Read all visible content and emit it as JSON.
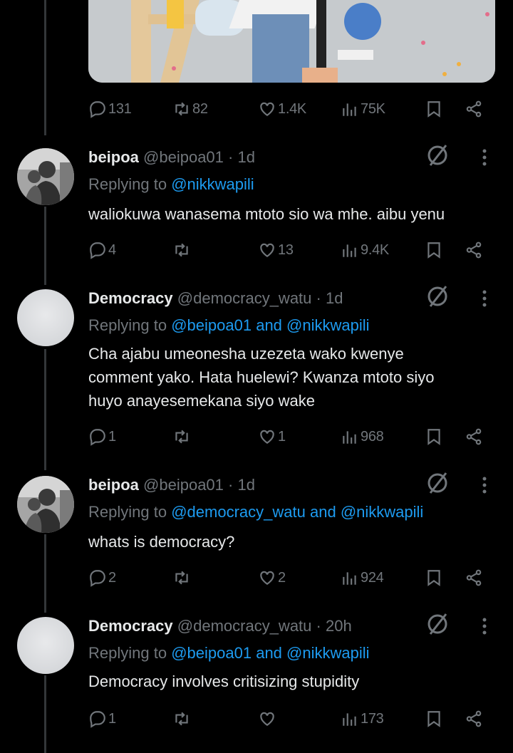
{
  "top_tweet": {
    "metrics": {
      "replies": "131",
      "reposts": "82",
      "likes": "1.4K",
      "views": "75K"
    }
  },
  "tweets": [
    {
      "name": "beipoa",
      "handle": "@beipoa01",
      "time": "· 1d",
      "replying_prefix": "Replying to",
      "replying_to": "@nikkwapili",
      "replying_and": "",
      "replying_to2": "",
      "text_lines": [
        "waliokuwa wanasema mtoto sio wa mhe. aibu yenu"
      ],
      "metrics": {
        "replies": "4",
        "reposts": "",
        "likes": "13",
        "views": "9.4K"
      },
      "avatar": "photo"
    },
    {
      "name": "Democracy",
      "handle": "@democracy_watu",
      "time": "· 1d",
      "replying_prefix": "Replying to",
      "replying_to": "@beipoa01",
      "replying_and": "and",
      "replying_to2": "@nikkwapili",
      "text_lines": [
        "Cha ajabu umeonesha uzezeta wako kwenye",
        "comment yako. Hata huelewi? Kwanza mtoto siyo",
        "huyo anayesemekana siyo wake"
      ],
      "metrics": {
        "replies": "1",
        "reposts": "",
        "likes": "1",
        "views": "968"
      },
      "avatar": "grey"
    },
    {
      "name": "beipoa",
      "handle": "@beipoa01",
      "time": "· 1d",
      "replying_prefix": "Replying to",
      "replying_to": "@democracy_watu",
      "replying_and": "and",
      "replying_to2": "@nikkwapili",
      "text_lines": [
        "whats is democracy?"
      ],
      "metrics": {
        "replies": "2",
        "reposts": "",
        "likes": "2",
        "views": "924"
      },
      "avatar": "photo"
    },
    {
      "name": "Democracy",
      "handle": "@democracy_watu",
      "time": "· 20h",
      "replying_prefix": "Replying to",
      "replying_to": "@beipoa01",
      "replying_and": "and",
      "replying_to2": "@nikkwapili",
      "text_lines": [
        "Democracy involves critisizing stupidity"
      ],
      "metrics": {
        "replies": "1",
        "reposts": "",
        "likes": "",
        "views": "173"
      },
      "avatar": "grey"
    }
  ],
  "icons": {
    "reply": "reply-icon",
    "repost": "repost-icon",
    "like": "like-icon",
    "views": "views-icon",
    "bookmark": "bookmark-icon",
    "share": "share-icon",
    "grok": "grok-icon",
    "more": "more-icon"
  },
  "colors": {
    "background": "#000000",
    "text": "#e7e9ea",
    "muted": "#71767b",
    "link": "#1d9bf0",
    "thread_line": "#333639"
  }
}
